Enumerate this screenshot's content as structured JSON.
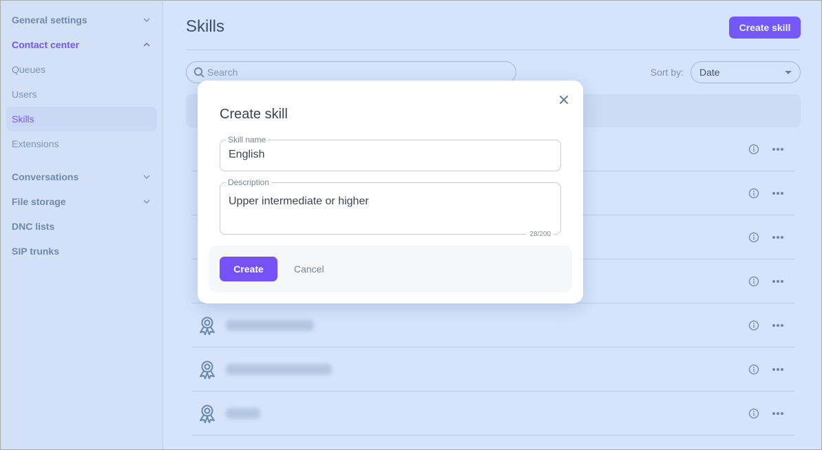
{
  "sidebar": {
    "items": [
      {
        "label": "General settings",
        "type": "group",
        "expanded": false
      },
      {
        "label": "Contact center",
        "type": "group",
        "expanded": true
      },
      {
        "label": "Queues",
        "type": "item"
      },
      {
        "label": "Users",
        "type": "item"
      },
      {
        "label": "Skills",
        "type": "item",
        "active": true
      },
      {
        "label": "Extensions",
        "type": "item"
      },
      {
        "label": "Conversations",
        "type": "group",
        "expanded": false
      },
      {
        "label": "File storage",
        "type": "group",
        "expanded": false
      },
      {
        "label": "DNC lists",
        "type": "group"
      },
      {
        "label": "SIP trunks",
        "type": "group"
      }
    ]
  },
  "header": {
    "title": "Skills",
    "create_button": "Create skill"
  },
  "toolbar": {
    "search_placeholder": "Search",
    "sort_label": "Sort by:",
    "sort_value": "Date"
  },
  "skills_list": {
    "rows_count": 7,
    "row_names_blurred": true,
    "icons": {
      "row": "award-icon",
      "info": "info-icon",
      "more": "more-horizontal-icon"
    }
  },
  "modal": {
    "title": "Create skill",
    "skill_name_label": "Skill name",
    "skill_name_value": "English",
    "description_label": "Description",
    "description_value": "Upper intermediate or higher",
    "char_counter": "28/200",
    "create_label": "Create",
    "cancel_label": "Cancel"
  },
  "colors": {
    "accent": "#7559f7",
    "background": "#d6e4fb",
    "sidebar": "#d3e1f7"
  }
}
